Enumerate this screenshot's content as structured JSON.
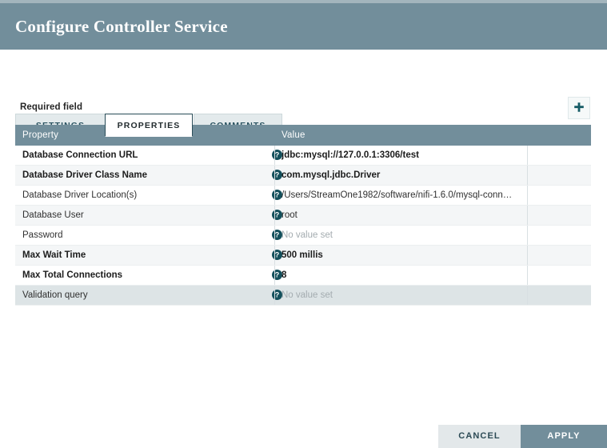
{
  "dialog": {
    "title": "Configure Controller Service",
    "accent_header_color": "#728e9b",
    "accent_teal_color": "#294c58"
  },
  "tabs": [
    {
      "label": "SETTINGS",
      "active": false
    },
    {
      "label": "PROPERTIES",
      "active": true
    },
    {
      "label": "COMMENTS",
      "active": false
    }
  ],
  "toolbar": {
    "required_field_label": "Required field",
    "add_property_icon": "plus-icon",
    "add_property_title": "Add property"
  },
  "table": {
    "columns": [
      "Property",
      "Value"
    ],
    "help_icon": "help-circle-icon",
    "unset_placeholder": "No value set",
    "rows": [
      {
        "property": "Database Connection URL",
        "value": "jdbc:mysql://127.0.0.1:3306/test",
        "required": true,
        "unset": false,
        "selected": false
      },
      {
        "property": "Database Driver Class Name",
        "value": "com.mysql.jdbc.Driver",
        "required": true,
        "unset": false,
        "selected": false
      },
      {
        "property": "Database Driver Location(s)",
        "value": "/Users/StreamOne1982/software/nifi-1.6.0/mysql-conn…",
        "required": false,
        "unset": false,
        "selected": false
      },
      {
        "property": "Database User",
        "value": "root",
        "required": false,
        "unset": false,
        "selected": false
      },
      {
        "property": "Password",
        "value": "No value set",
        "required": false,
        "unset": true,
        "selected": false
      },
      {
        "property": "Max Wait Time",
        "value": "500 millis",
        "required": true,
        "unset": false,
        "selected": false
      },
      {
        "property": "Max Total Connections",
        "value": "8",
        "required": true,
        "unset": false,
        "selected": false
      },
      {
        "property": "Validation query",
        "value": "No value set",
        "required": false,
        "unset": true,
        "selected": true
      }
    ]
  },
  "footer": {
    "cancel_label": "CANCEL",
    "apply_label": "APPLY"
  }
}
